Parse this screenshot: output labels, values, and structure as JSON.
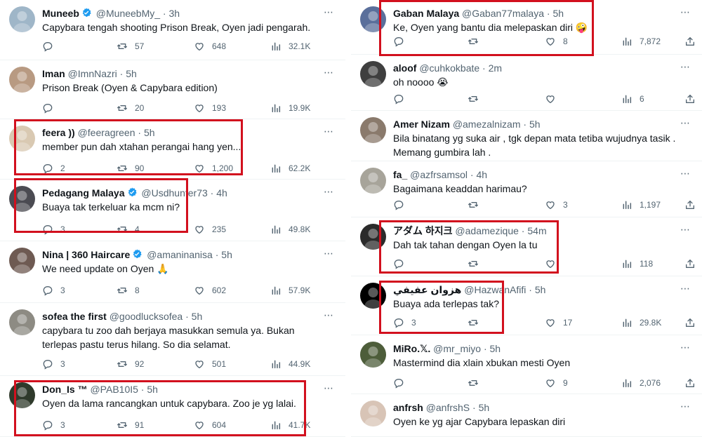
{
  "left": [
    {
      "name": "Muneeb",
      "handle": "@MuneebMy_",
      "time": "3h",
      "verified": true,
      "text": "Capybara tengah shooting Prison Break, Oyen jadi pengarah.",
      "reply": "",
      "retweet": "57",
      "like": "648",
      "views": "32.1K"
    },
    {
      "name": "Iman",
      "handle": "@ImnNazri",
      "time": "5h",
      "verified": false,
      "text": "Prison Break (Oyen & Capybara edition)",
      "reply": "",
      "retweet": "20",
      "like": "193",
      "views": "19.9K"
    },
    {
      "name": "feera ))",
      "handle": "@feeragreen",
      "time": "5h",
      "verified": false,
      "text": "member pun dah xtahan perangai hang yen...",
      "reply": "2",
      "retweet": "90",
      "like": "1,200",
      "views": "62.2K"
    },
    {
      "name": "Pedagang Malaya",
      "handle": "@Usdhunter73",
      "time": "4h",
      "verified": true,
      "text": "Buaya tak terkeluar ka mcm ni?",
      "reply": "3",
      "retweet": "4",
      "like": "235",
      "views": "49.8K"
    },
    {
      "name": "Nina | 360 Haircare",
      "handle": "@amaninanisa",
      "time": "5h",
      "verified": true,
      "text": "We need update on Oyen 🙏",
      "reply": "3",
      "retweet": "8",
      "like": "602",
      "views": "57.9K"
    },
    {
      "name": "sofea the first",
      "handle": "@goodlucksofea",
      "time": "5h",
      "verified": false,
      "text": "capybara tu zoo dah berjaya masukkan semula ya. Bukan terlepas pastu terus hilang. So dia selamat.",
      "reply": "3",
      "retweet": "92",
      "like": "501",
      "views": "44.9K"
    },
    {
      "name": "Don_Is ™",
      "handle": "@PAB10I5",
      "time": "5h",
      "verified": false,
      "text": "Oyen da lama rancangkan untuk capybara. Zoo je yg lalai.",
      "reply": "3",
      "retweet": "91",
      "like": "604",
      "views": "41.7K"
    }
  ],
  "right": [
    {
      "name": "Gaban Malaya",
      "handle": "@Gaban77malaya",
      "time": "5h",
      "verified": false,
      "text": "Ke, Oyen yang bantu dia melepaskan diri 🤪",
      "reply": "",
      "retweet": "",
      "like": "8",
      "views": "7,872"
    },
    {
      "name": "aloof",
      "handle": "@cuhkokbate",
      "time": "2m",
      "verified": false,
      "text": "oh noooo 😭",
      "reply": "",
      "retweet": "",
      "like": "",
      "views": "6"
    },
    {
      "name": "Amer Nizam",
      "handle": "@amezalnizam",
      "time": "5h",
      "verified": false,
      "text": "Bila binatang yg suka air , tgk depan mata tetiba wujudnya tasik . Memang gumbira lah .",
      "reply": "",
      "retweet": "",
      "like": "",
      "views": ""
    },
    {
      "name": "fa_",
      "handle": "@azfrsamsol",
      "time": "4h",
      "verified": false,
      "text": "Bagaimana keaddan harimau?",
      "reply": "",
      "retweet": "",
      "like": "3",
      "views": "1,197"
    },
    {
      "name": "アダム 하지크",
      "handle": "@adamezique",
      "time": "54m",
      "verified": false,
      "text": "Dah tak tahan dengan Oyen la tu",
      "reply": "",
      "retweet": "",
      "like": "",
      "views": "118"
    },
    {
      "name": "هزوان عفيفي",
      "handle": "@HazwanAfifi",
      "time": "5h",
      "verified": false,
      "text": "Buaya ada terlepas tak?",
      "reply": "3",
      "retweet": "",
      "like": "17",
      "views": "29.8K"
    },
    {
      "name": "MiRo.𝕏.",
      "handle": "@mr_miyo",
      "time": "5h",
      "verified": false,
      "text": "Mastermind dia xlain xbukan mesti Oyen",
      "reply": "",
      "retweet": "",
      "like": "9",
      "views": "2,076"
    },
    {
      "name": "anfrsh",
      "handle": "@anfrshS",
      "time": "5h",
      "verified": false,
      "text": "Oyen ke yg ajar Capybara lepaskan diri",
      "reply": "",
      "retweet": "",
      "like": "",
      "views": ""
    }
  ],
  "colors": {
    "highlight": "#d2101e",
    "verified": "#1d9bf0",
    "muted": "#536471"
  }
}
